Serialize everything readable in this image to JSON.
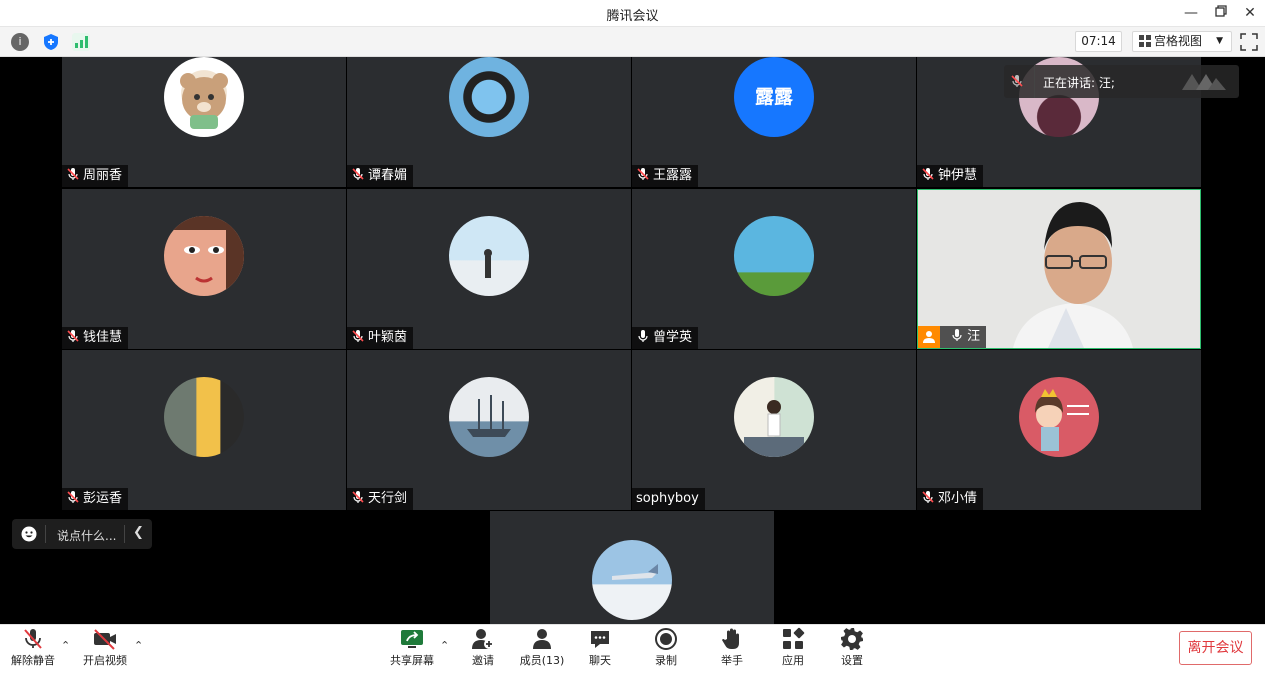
{
  "window": {
    "title": "腾讯会议"
  },
  "top_toolbar": {
    "timer": "07:14",
    "view_mode": "宫格视图"
  },
  "speaking": {
    "label": "正在讲话: 汪;"
  },
  "participants": [
    {
      "name": "周丽香",
      "muted": true
    },
    {
      "name": "谭春媚",
      "muted": true
    },
    {
      "name": "王露露",
      "muted": true,
      "avatar_text": "露露"
    },
    {
      "name": "钟伊慧",
      "muted": true
    },
    {
      "name": "钱佳慧",
      "muted": true
    },
    {
      "name": "叶颖茵",
      "muted": true
    },
    {
      "name": "曾学英",
      "muted": false
    },
    {
      "name": "汪",
      "muted": false,
      "video_on": true,
      "host": true
    },
    {
      "name": "彭运香",
      "muted": true
    },
    {
      "name": "天行剑",
      "muted": true
    },
    {
      "name": "sophyboy",
      "muted": false
    },
    {
      "name": "邓小倩",
      "muted": true
    }
  ],
  "chat_input": {
    "placeholder": "说点什么..."
  },
  "bottom_bar": {
    "unmute": "解除静音",
    "start_video": "开启视频",
    "share_screen": "共享屏幕",
    "invite": "邀请",
    "members": "成员(13)",
    "chat": "聊天",
    "record": "录制",
    "raise_hand": "举手",
    "apps": "应用",
    "settings": "设置",
    "leave": "离开会议"
  },
  "colors": {
    "accent_blue": "#1677ff",
    "leave_red": "#e0393e",
    "active_green": "#2ebd6e",
    "host_orange": "#ff8a00"
  }
}
